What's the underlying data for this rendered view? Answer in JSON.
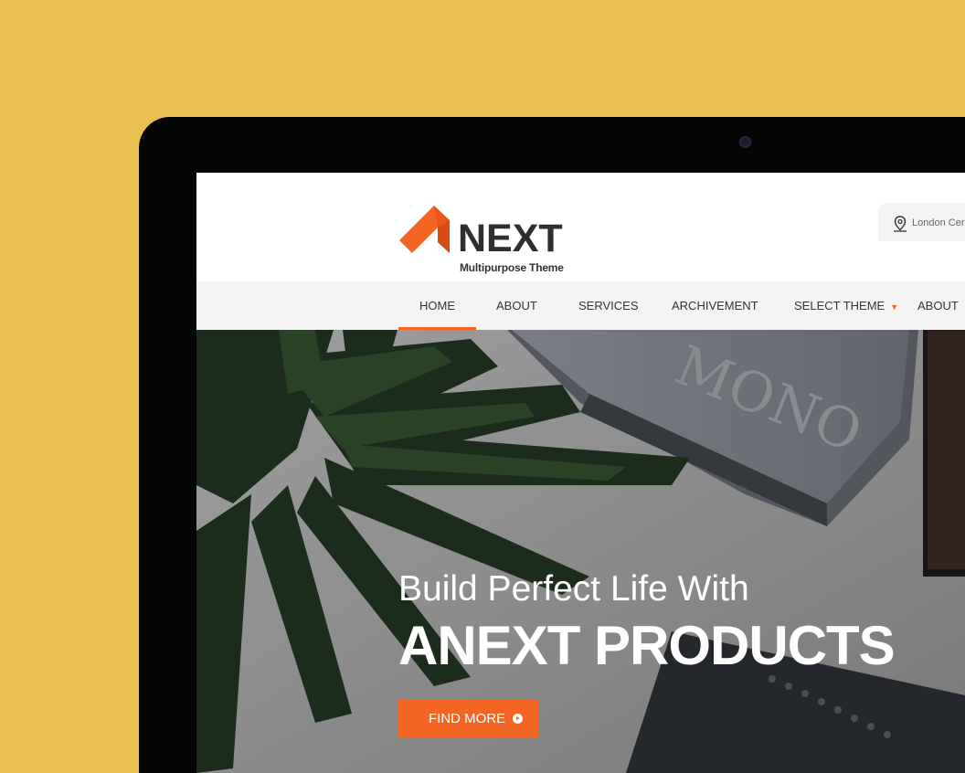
{
  "brand": {
    "name": "NEXT",
    "tagline": "Multipurpose Theme",
    "accent": "#F26522"
  },
  "header": {
    "location_text": "London Cer"
  },
  "nav": {
    "items": [
      {
        "label": "HOME",
        "active": true
      },
      {
        "label": "ABOUT"
      },
      {
        "label": "SERVICES"
      },
      {
        "label": "ARCHIVEMENT"
      },
      {
        "label": "SELECT THEME",
        "has_dropdown": true
      },
      {
        "label": "ABOUT"
      }
    ]
  },
  "hero": {
    "line1": "Build Perfect Life With",
    "line2": "ANEXT PRODUCTS",
    "button_label": "FIND MORE"
  },
  "colors": {
    "background": "#EBC050",
    "device": "#050505",
    "nav_bg": "#F4F4F4"
  }
}
